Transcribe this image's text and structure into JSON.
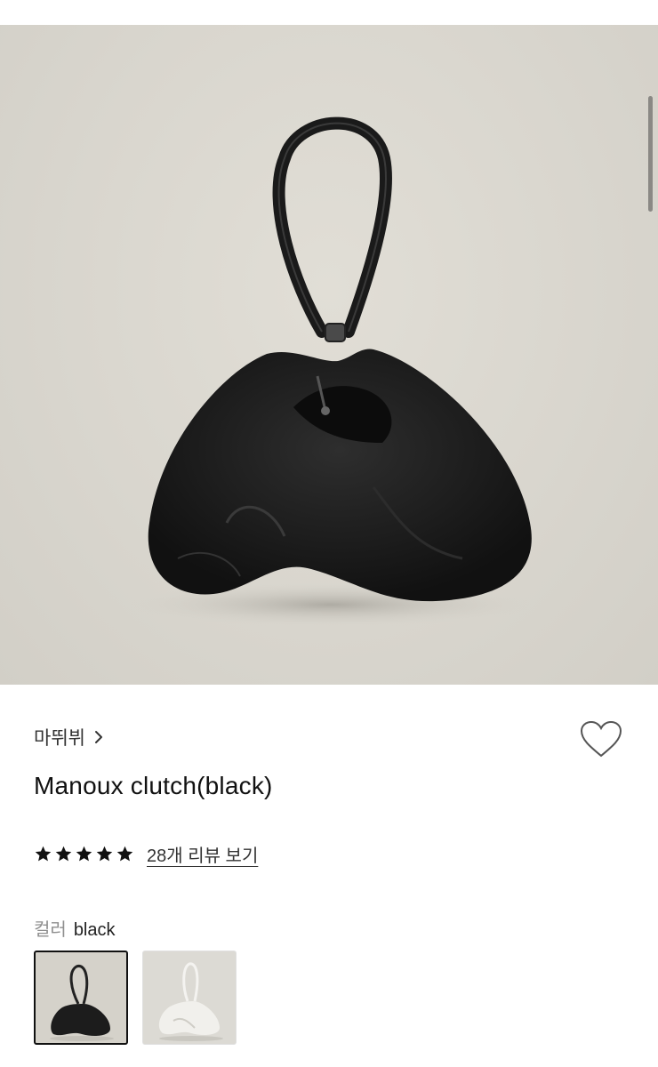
{
  "product": {
    "brand": "마뛰뷔",
    "title": "Manoux clutch(black)",
    "rating": 5,
    "rating_max": 5,
    "reviews_link": "28개 리뷰 보기",
    "color_label": "컬러",
    "color_value": "black"
  },
  "swatches": [
    {
      "name": "black",
      "selected": true
    },
    {
      "name": "white",
      "selected": false
    }
  ],
  "colors": {
    "hero_background": "#d9d6ce",
    "bag": "#1c1c1c",
    "text_primary": "#111111",
    "text_muted": "#8f8f8f"
  },
  "icons": {
    "wishlist": "heart-outline-icon",
    "brand_more": "chevron-right-icon",
    "rating": "star-icon"
  }
}
